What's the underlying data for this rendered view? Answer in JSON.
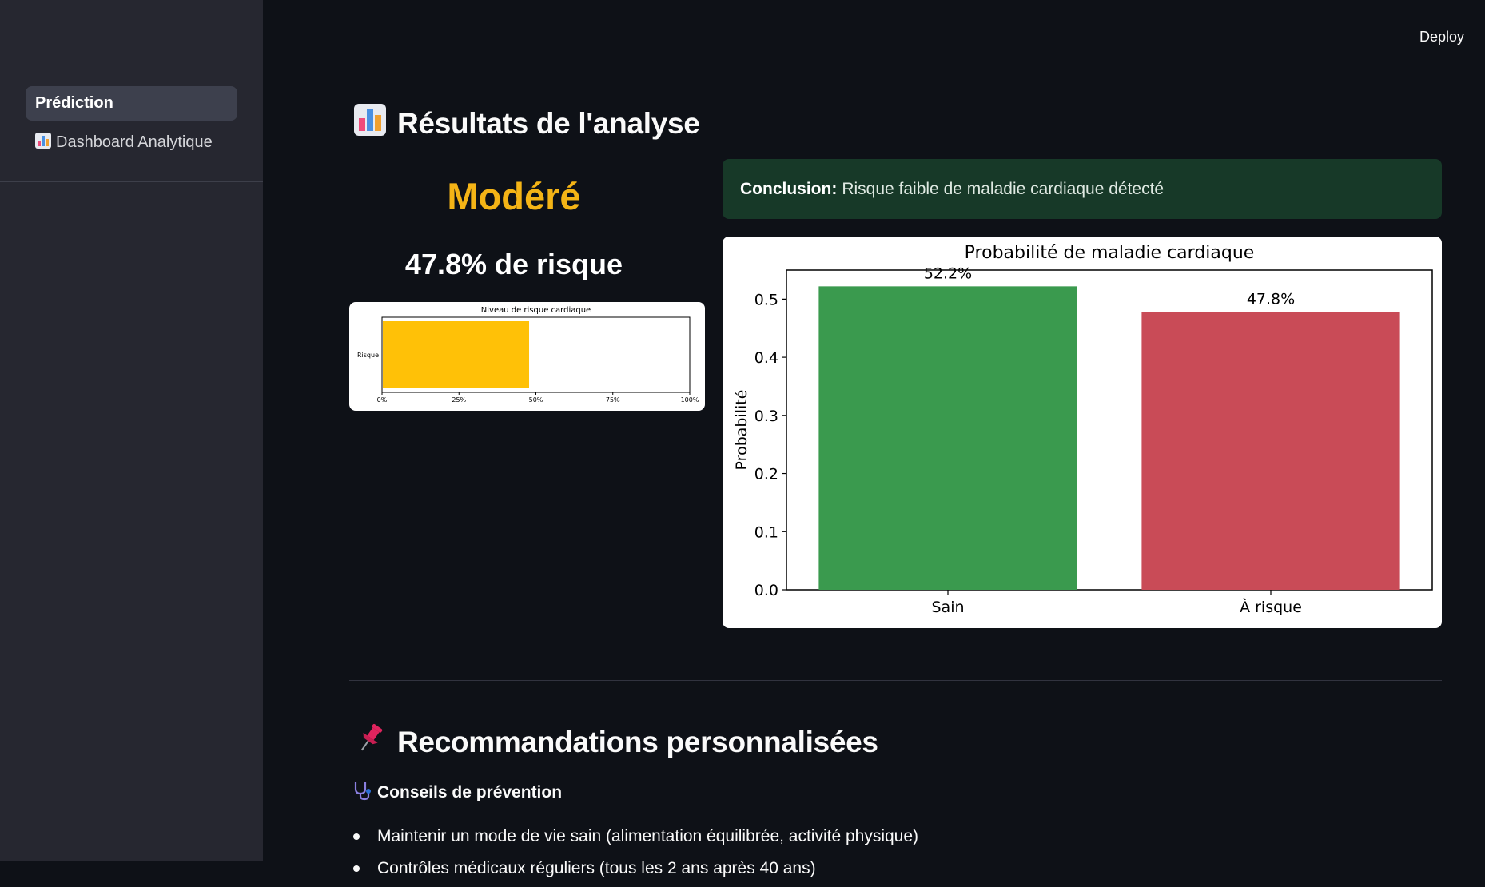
{
  "sidebar": {
    "items": [
      {
        "label": "Prédiction",
        "active": true
      },
      {
        "label": "Dashboard Analytique",
        "icon": "bar-chart-icon"
      }
    ]
  },
  "header": {
    "deploy_label": "Deploy"
  },
  "results": {
    "title": "Résultats de l'analyse",
    "title_icon": "bar-chart-icon",
    "risk_level": "Modéré",
    "risk_level_color": "#f4b416",
    "risk_percent": "47.8% de risque"
  },
  "conclusion": {
    "label": "Conclusion:",
    "text": "Risque faible de maladie cardiaque détecté",
    "bg_color": "#173928"
  },
  "recommendations": {
    "title": "Recommandations personnalisées",
    "title_icon": "pushpin-icon",
    "subtitle": "Conseils de prévention",
    "subtitle_icon": "stethoscope-icon",
    "items": [
      "Maintenir un mode de vie sain (alimentation équilibrée, activité physique)",
      "Contrôles médicaux réguliers (tous les 2 ans après 40 ans)"
    ]
  },
  "chart_data": [
    {
      "type": "bar",
      "orientation": "horizontal",
      "title": "Niveau de risque cardiaque",
      "categories": [
        "Risque"
      ],
      "values": [
        47.8
      ],
      "xlim": [
        0,
        100
      ],
      "xticks": [
        "0%",
        "25%",
        "50%",
        "75%",
        "100%"
      ],
      "color": "#ffc107"
    },
    {
      "type": "bar",
      "title": "Probabilité de maladie cardiaque",
      "categories": [
        "Sain",
        "À risque"
      ],
      "values": [
        0.522,
        0.478
      ],
      "data_labels": [
        "52.2%",
        "47.8%"
      ],
      "colors": [
        "#3a9a4e",
        "#c94b57"
      ],
      "ylabel": "Probabilité",
      "ylim": [
        0,
        0.55
      ],
      "yticks": [
        "0.0",
        "0.1",
        "0.2",
        "0.3",
        "0.4",
        "0.5"
      ],
      "grid": false
    }
  ]
}
